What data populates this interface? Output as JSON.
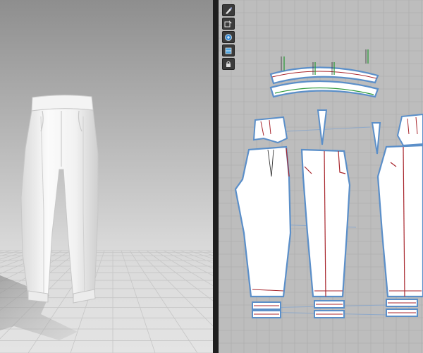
{
  "app": {
    "colors": {
      "viewport_3d_top": "#8e8e8e",
      "viewport_3d_bottom": "#e4e4e4",
      "viewport_2d_bg": "#bdbdbd",
      "pattern_outline": "#5b8fc9",
      "seam_red": "#a8262d",
      "seam_green": "#2e9a3a",
      "garment_fill": "#ffffff"
    },
    "viewport_3d": {
      "icons": [
        "garment-pants-icon",
        "floor-grid-icon",
        "avatar-shadow-icon"
      ]
    },
    "viewport_2d": {
      "toolbar": [
        {
          "icon": "brush-icon"
        },
        {
          "icon": "pattern-select-icon"
        },
        {
          "icon": "zoom-icon"
        },
        {
          "icon": "fabric-icon"
        },
        {
          "icon": "lock-icon"
        }
      ]
    }
  }
}
